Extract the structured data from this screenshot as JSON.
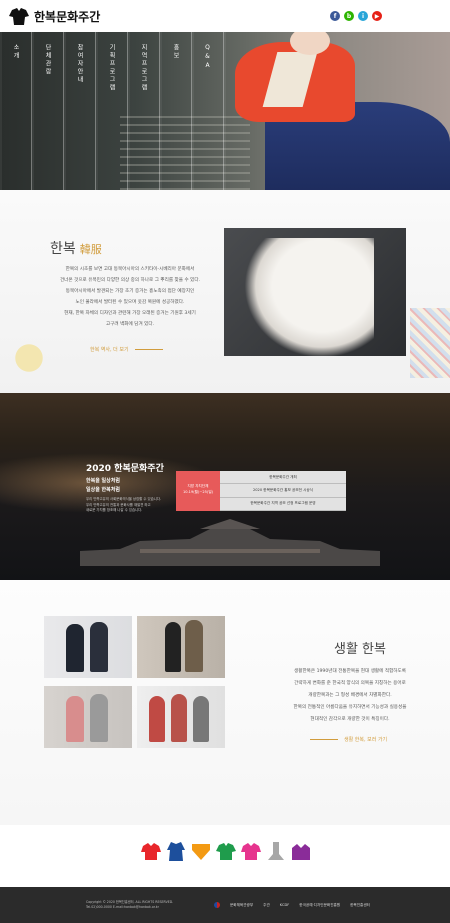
{
  "header": {
    "site_name": "한복문화주간",
    "social": [
      {
        "icon": "facebook-icon",
        "label": "f",
        "color": "#3b5998"
      },
      {
        "icon": "blog-icon",
        "label": "b",
        "color": "#2db400"
      },
      {
        "icon": "instagram-icon",
        "label": "i",
        "color": "#28a5d8"
      },
      {
        "icon": "youtube-icon",
        "label": "▶",
        "color": "#e62117"
      }
    ]
  },
  "nav": {
    "items": [
      {
        "label": "소개"
      },
      {
        "label": "단체관람"
      },
      {
        "label": "참여자안내"
      },
      {
        "label": "기획프로그램"
      },
      {
        "label": "지역프로그램"
      },
      {
        "label": "홍보"
      },
      {
        "label": "Q&A"
      }
    ]
  },
  "hanbok": {
    "title": "한복",
    "title_hanja": "韓服",
    "body": [
      "한복의 시초를 보면 고대 동북아시아의 스키타이-시베리아 문화에서",
      "건너온 것으로 유목민의 다양한 의상 중의 하나로 그 뿌리를 찾을 수 있다.",
      "동북아시아에서 발견되는 가장 초기 증거는 흉노족의 접단 예장지인",
      "노인 울라에서 발터된 수 있으며 옷감 복원에 성공하였다.",
      "현재, 한복 자체의 디자인과 관련해 가장 오래된 증거는 기원후 3세기",
      "고구려 벽화에 담겨 있다."
    ],
    "link_label": "한복 역사, 더 보기"
  },
  "week": {
    "title": "2020 한복문화주간",
    "subtitle_1": "한복을 일상처럼",
    "subtitle_2": "일상을 한복처럼",
    "desc": [
      "우리 민족고유의 사회문화의식을 상징할 수 있습니다.",
      "우리 민족고유의 전통과 문화사를 재발견 하고",
      "새로운 가치를 창조해 나갈 수 있습니다."
    ],
    "box_line_1": "지방 자치단체",
    "box_line_2": "10.19(월)~25(일)",
    "list": [
      "한복문화주간 개최",
      "2020 한복문화주간 홍보 공모전 시상식",
      "한복문화주간 지역 공모 선정 프로그램 운영"
    ]
  },
  "life": {
    "title": "생활 한복",
    "body": [
      "생활한복은 1990년대 전통한복을 현대 생활에 적합하도록",
      "간략하게 변화를 준 한국적 양식의 의복을 지칭하는 용어로",
      "개량한복과는 그 형성 배경에서 차별화한다.",
      "한복의 전통적인 아름다움을 유지하면서 기능성과 실용성을",
      "현대적인 감각으로 개량한 것이 특징이다."
    ],
    "link_label": "생활 한복, 보러 가기"
  },
  "hanbok_icons": [
    {
      "icon": "jeogori-icon",
      "color": "#e8262b"
    },
    {
      "icon": "durumagi-icon",
      "color": "#1d4f9c"
    },
    {
      "icon": "norigae-icon",
      "color": "#f39a13"
    },
    {
      "icon": "jeogori-green-icon",
      "color": "#1f9c4c"
    },
    {
      "icon": "jeogori-pink-icon",
      "color": "#e6348e"
    },
    {
      "icon": "beoseon-icon",
      "color": "#a7a7a7"
    },
    {
      "icon": "hat-icon",
      "color": "#8a2c99"
    }
  ],
  "footer": {
    "copyright": "Copyright © 2020 한복진흥센터. ALL RIGHTS RESERVED.",
    "contact": "Tel.02)000-0000  E-mail:hanbok@hanbok.or.kr",
    "org_1": "문화체육관광부",
    "label_host": "주관",
    "org_2": "KCDF",
    "org_3": "한국공예·디자인문화진흥원",
    "org_4": "한복진흥센터"
  }
}
